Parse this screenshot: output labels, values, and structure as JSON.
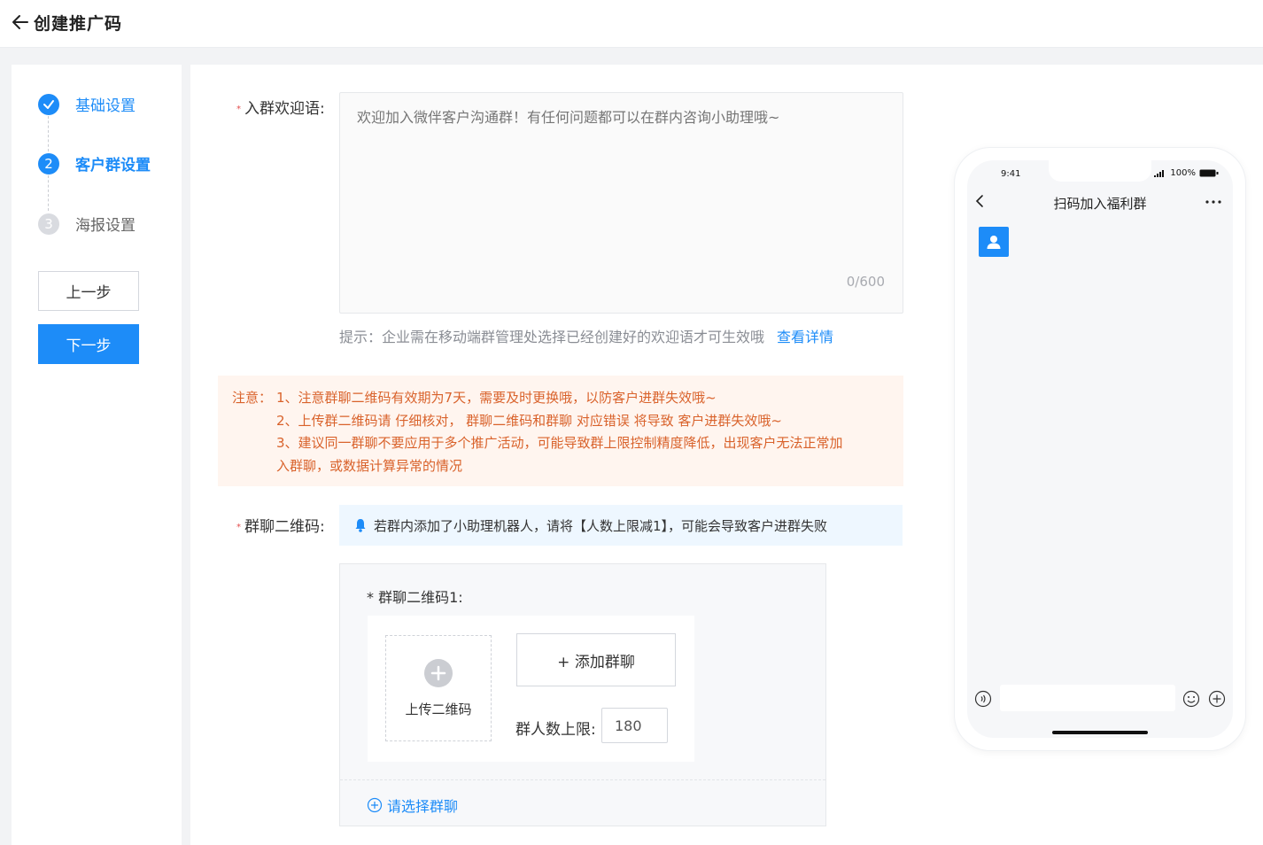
{
  "header": {
    "title": "创建推广码"
  },
  "steps": [
    {
      "number": "",
      "label": "基础设置",
      "state": "done"
    },
    {
      "number": "2",
      "label": "客户群设置",
      "state": "active"
    },
    {
      "number": "3",
      "label": "海报设置",
      "state": "pending"
    }
  ],
  "nav_buttons": {
    "prev": "上一步",
    "next": "下一步"
  },
  "form": {
    "welcome": {
      "label": "入群欢迎语:",
      "placeholder": "欢迎加入微伴客户沟通群！有任何问题都可以在群内咨询小助理哦~",
      "count": "0/600"
    },
    "hint": {
      "text": "提示：企业需在移动端群管理处选择已经创建好的欢迎语才可生效哦",
      "link": "查看详情"
    },
    "notice": {
      "prefix": "注意：",
      "lines": [
        "1、注意群聊二维码有效期为7天，需要及时更换哦，以防客户进群失效哦~",
        "2、上传群二维码请 仔细核对， 群聊二维码和群聊 对应错误 将导致 客户进群失效哦~",
        "3、建议同一群聊不要应用于多个推广活动，可能导致群上限控制精度降低，出现客户无法正常加",
        "入群聊，或数据计算异常的情况"
      ]
    },
    "qr": {
      "label": "群聊二维码:",
      "tip": "若群内添加了小助理机器人，请将【人数上限减1】，可能会导致客户进群失败",
      "card_title": "* 群聊二维码1:",
      "upload_label": "上传二维码",
      "add_group": "+ 添加群聊",
      "limit_label": "群人数上限:",
      "limit_value": "180",
      "select_group": "请选择群聊"
    }
  },
  "phone": {
    "time": "9:41",
    "battery": "100%",
    "title": "扫码加入福利群"
  },
  "colors": {
    "primary": "#1d8cf8",
    "notice_text": "#d9622b",
    "notice_bg": "#fff5ef",
    "tip_bg": "#eef7ff"
  }
}
